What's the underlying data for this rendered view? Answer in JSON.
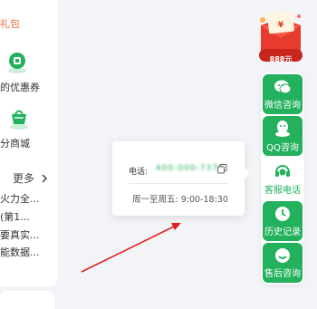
{
  "colors": {
    "brand_green": "#23b15d",
    "annotation_red": "#e02020",
    "gift_orange": "#f06a34"
  },
  "left_panel": {
    "gift_link": "礼包",
    "coupon_label": "的优惠券",
    "mall_label": "分商城",
    "more_label": "更多",
    "items": [
      "火力全...",
      "(第1...",
      "要真实...",
      "能数据..."
    ],
    "icons": [
      "coupon-icon",
      "points-mall-icon",
      "chevron-right-icon"
    ]
  },
  "promo": {
    "price": "888元",
    "icon": "red-envelope-icon"
  },
  "right_rail": {
    "items": [
      {
        "label": "微信咨询",
        "icon": "wechat-icon",
        "active": false
      },
      {
        "label": "QQ咨询",
        "icon": "qq-icon",
        "active": false
      },
      {
        "label": "客服电话",
        "icon": "headset-icon",
        "active": true
      },
      {
        "label": "历史记录",
        "icon": "clock-icon",
        "active": false
      },
      {
        "label": "售后咨询",
        "icon": "chat-smile-icon",
        "active": false
      }
    ]
  },
  "phone_popup": {
    "phone_label": "电话:",
    "phone_number": "400-000-7376",
    "hours": "周一至周五: 9:00-18:30",
    "copy_icon": "copy-icon"
  }
}
